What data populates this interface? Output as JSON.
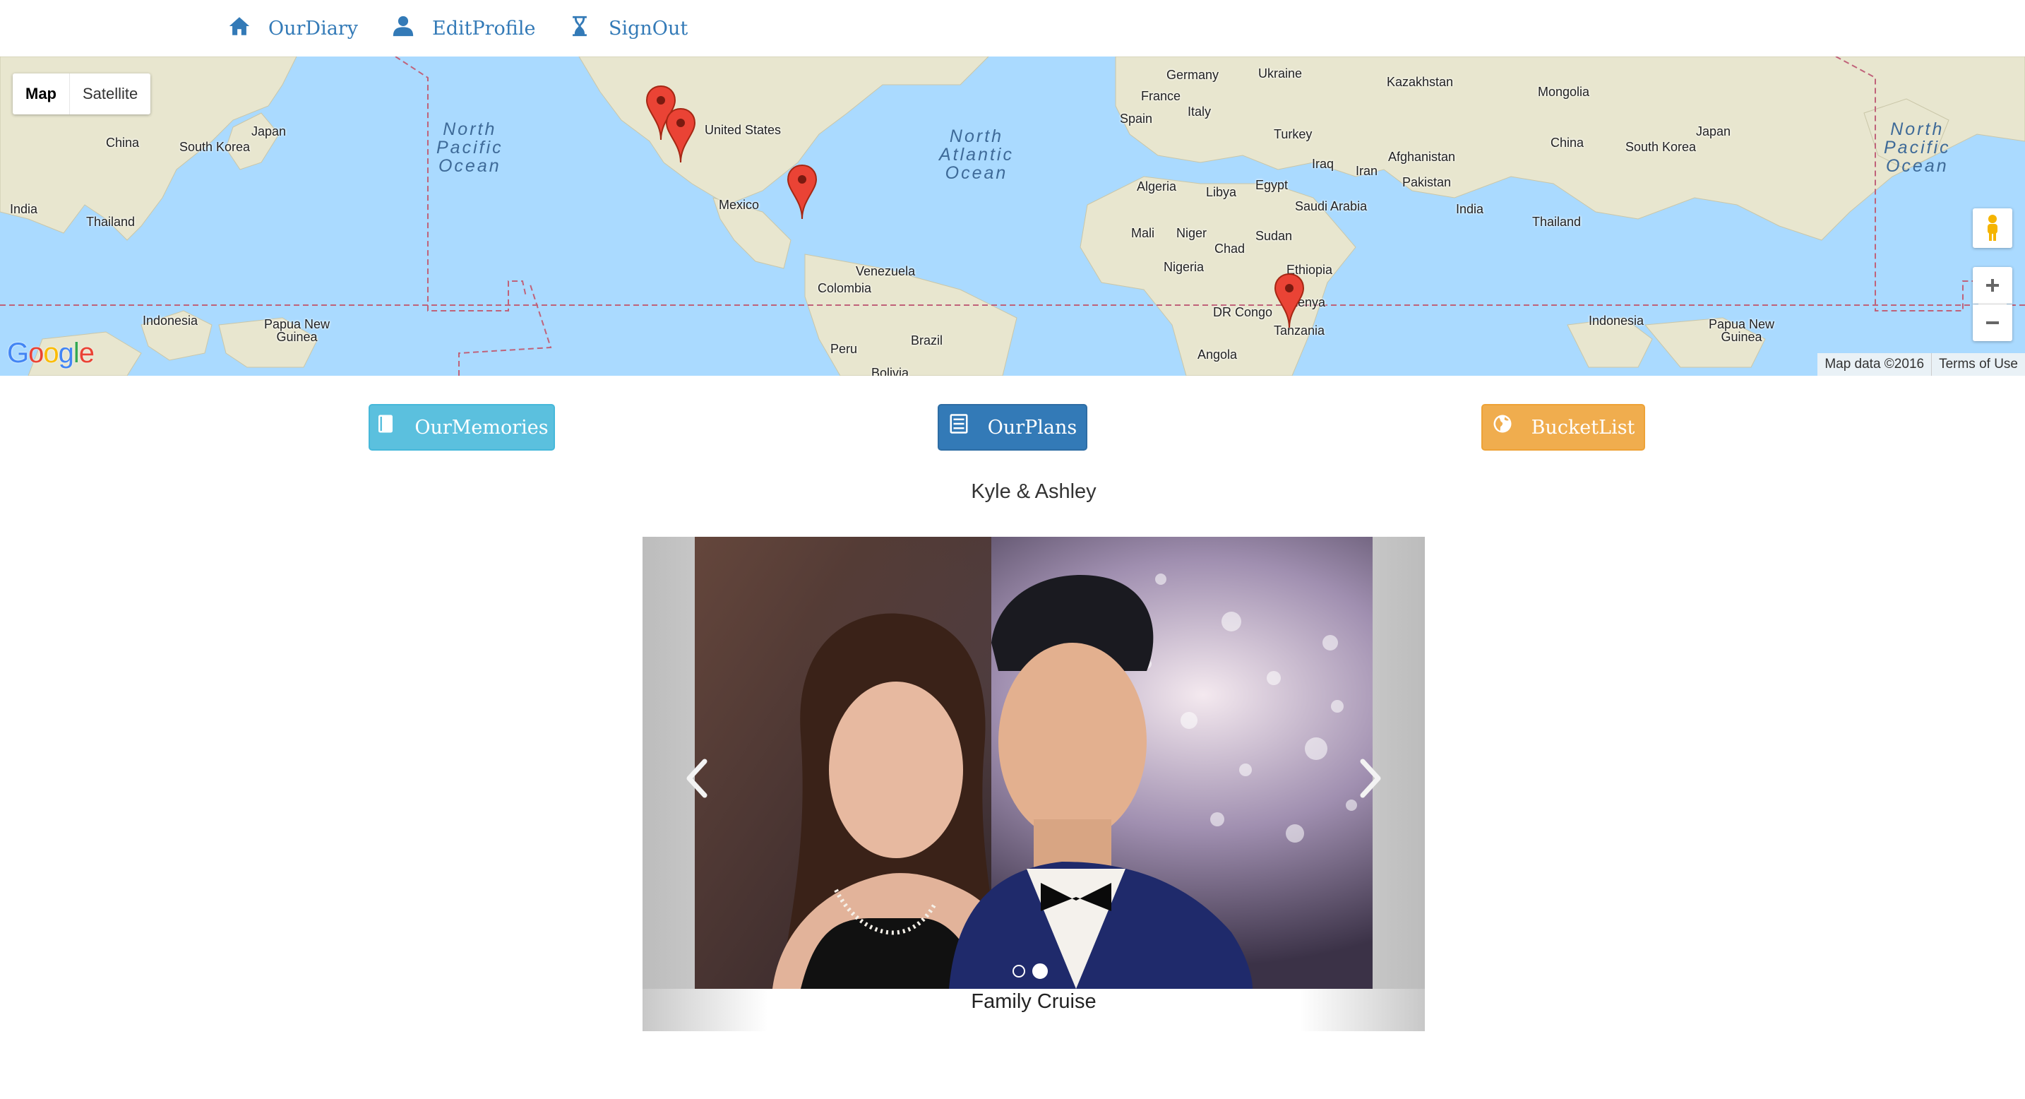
{
  "nav": {
    "items": [
      {
        "label": "OurDiary",
        "icon": "home-icon"
      },
      {
        "label": "EditProfile",
        "icon": "user-icon"
      },
      {
        "label": "SignOut",
        "icon": "hourglass-icon"
      }
    ],
    "link_color": "#337ab7"
  },
  "map": {
    "type_control": {
      "map": "Map",
      "satellite": "Satellite",
      "selected": "Map"
    },
    "oceans": {
      "pacific": "North\nPacific\nOcean",
      "atlantic": "North\nAtlantic\nOcean"
    },
    "labels": {
      "china_l": "China",
      "japan_l": "Japan",
      "south_korea_l": "South Korea",
      "india_l": "India",
      "thailand_l": "Thailand",
      "indonesia_l": "Indonesia",
      "png_l": "Papua New\nGuinea",
      "united_states": "United States",
      "mexico": "Mexico",
      "venezuela": "Venezuela",
      "colombia": "Colombia",
      "peru": "Peru",
      "brazil": "Brazil",
      "bolivia": "Bolivia",
      "germany": "Germany",
      "ukraine": "Ukraine",
      "france": "France",
      "spain": "Spain",
      "italy": "Italy",
      "turkey": "Turkey",
      "iraq": "Iraq",
      "iran": "Iran",
      "kazakhstan": "Kazakhstan",
      "mongolia": "Mongolia",
      "afghanistan": "Afghanistan",
      "pakistan": "Pakistan",
      "algeria": "Algeria",
      "libya": "Libya",
      "egypt": "Egypt",
      "saudi_arabia": "Saudi Arabia",
      "mali": "Mali",
      "niger": "Niger",
      "chad": "Chad",
      "sudan": "Sudan",
      "nigeria": "Nigeria",
      "ethiopia": "Ethiopia",
      "dr_congo": "DR Congo",
      "kenya": "Kenya",
      "tanzania": "Tanzania",
      "angola": "Angola",
      "china_r": "China",
      "japan_r": "Japan",
      "south_korea_r": "South Korea",
      "india_r": "India",
      "thailand_r": "Thailand",
      "indonesia_r": "Indonesia",
      "png_r": "Papua New\nGuinea"
    },
    "markers": [
      "marker-west-coast-1",
      "marker-west-coast-2",
      "marker-florida",
      "marker-tanzania"
    ],
    "footer": {
      "data": "Map data ©2016",
      "terms": "Terms of Use"
    },
    "logo": "Google",
    "water_color": "#aadaff",
    "land_color": "#e8e4d0"
  },
  "actions": {
    "memories": {
      "label": "OurMemories",
      "color": "#5bc0de",
      "icon": "book-icon"
    },
    "plans": {
      "label": "OurPlans",
      "color": "#337ab7",
      "icon": "list-icon"
    },
    "bucket": {
      "label": "BucketList",
      "color": "#f0ad4e",
      "icon": "globe-icon"
    }
  },
  "couple_name": "Kyle & Ashley",
  "carousel": {
    "caption": "Family Cruise",
    "slide_count": 2,
    "active_slide": 2
  }
}
